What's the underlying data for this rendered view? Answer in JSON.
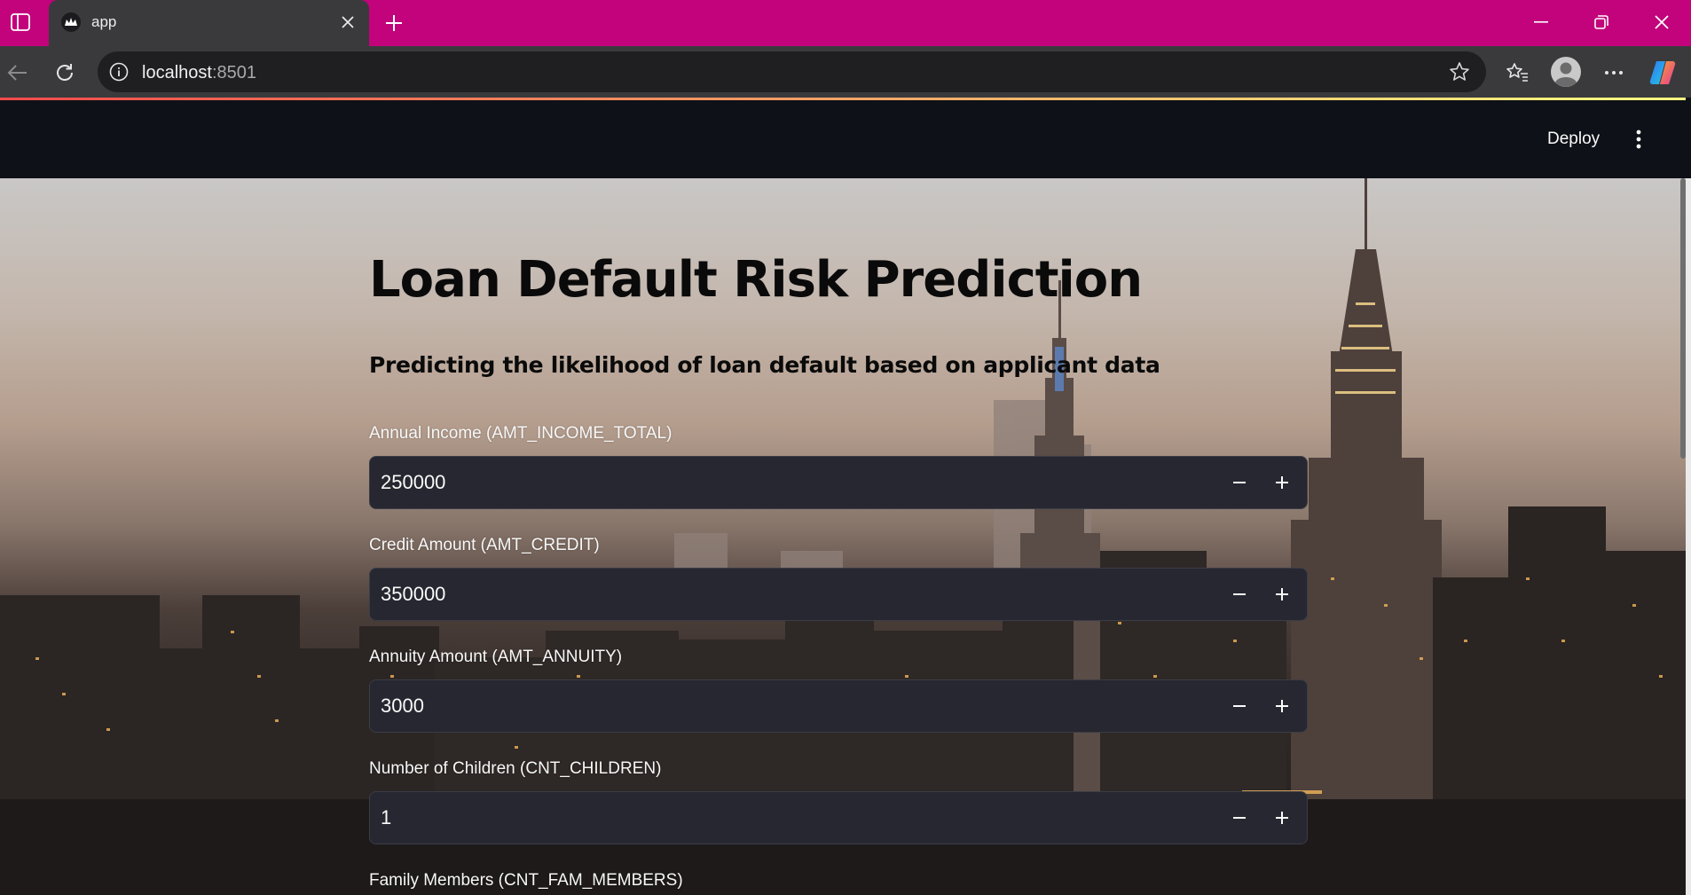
{
  "browser": {
    "tab_title": "app",
    "url_host": "localhost",
    "url_port": ":8501"
  },
  "header": {
    "deploy_label": "Deploy"
  },
  "main": {
    "title": "Loan Default Risk Prediction",
    "subtitle": "Predicting the likelihood of loan default based on applicant data",
    "fields": [
      {
        "label": "Annual Income (AMT_INCOME_TOTAL)",
        "value": "250000"
      },
      {
        "label": "Credit Amount (AMT_CREDIT)",
        "value": "350000"
      },
      {
        "label": "Annuity Amount (AMT_ANNUITY)",
        "value": "3000"
      },
      {
        "label": "Number of Children (CNT_CHILDREN)",
        "value": "1"
      },
      {
        "label": "Family Members (CNT_FAM_MEMBERS)",
        "value": ""
      }
    ]
  },
  "colors": {
    "titlebar": "#c2037b",
    "chrome": "#3a3a3d",
    "app_header": "#0e1117",
    "input_bg": "#262730"
  },
  "icons": {
    "minus": "minus-icon",
    "plus": "plus-icon"
  }
}
